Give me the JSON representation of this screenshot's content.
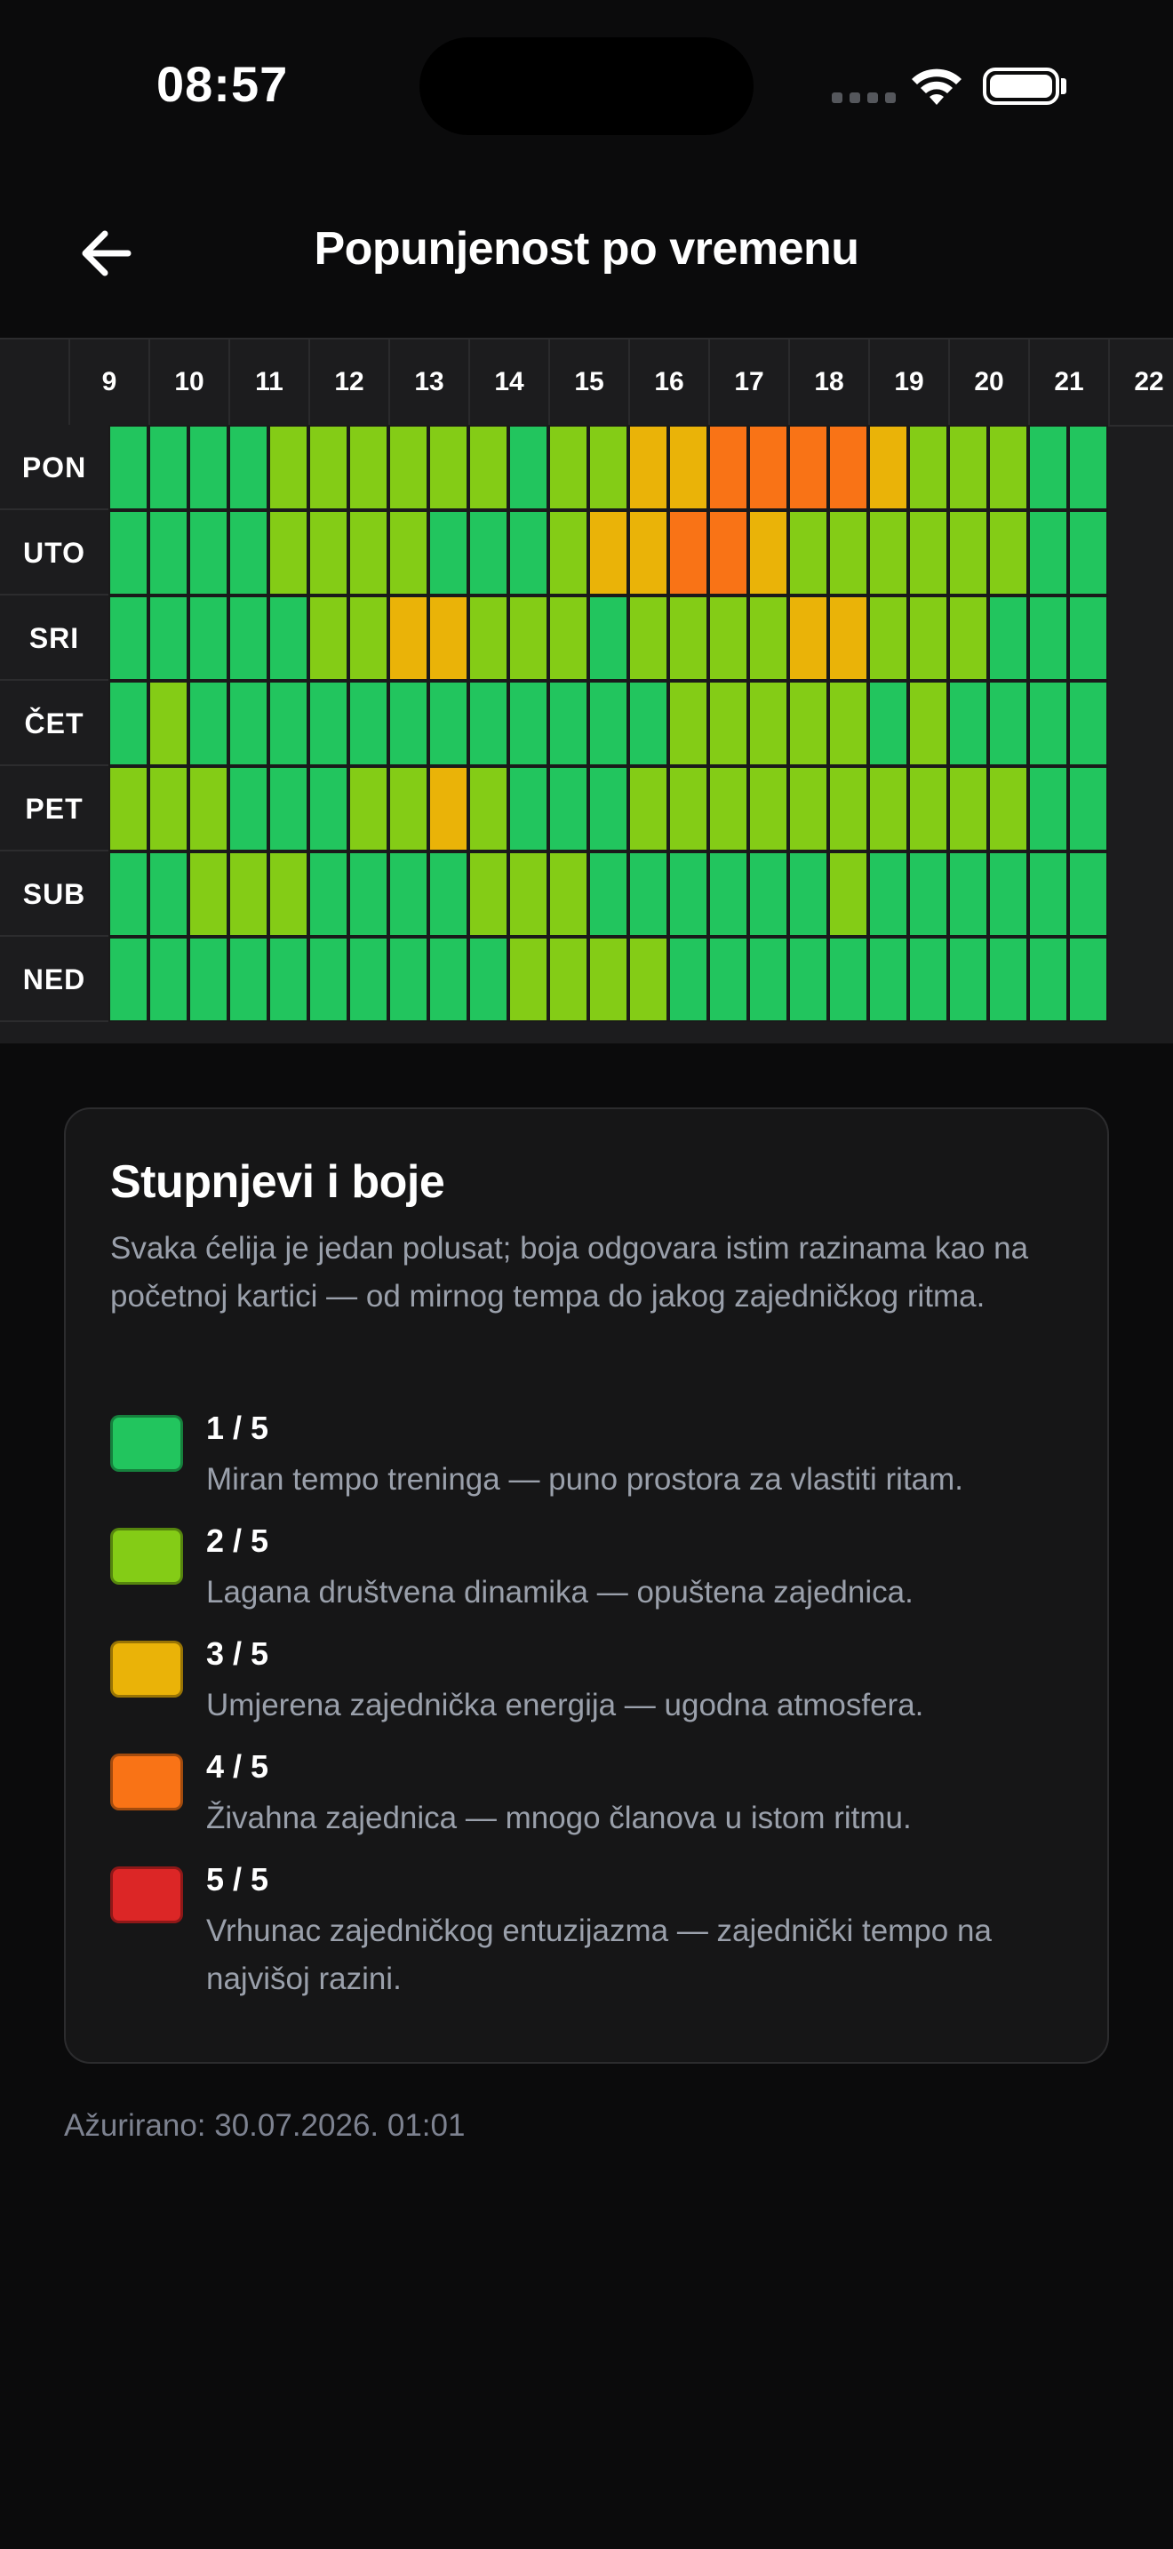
{
  "status_bar": {
    "time": "08:57"
  },
  "header": {
    "title": "Popunjenost po vremenu",
    "back_icon": "arrow-left-icon"
  },
  "heatmap": {
    "hours": [
      "9",
      "10",
      "11",
      "12",
      "13",
      "14",
      "15",
      "16",
      "17",
      "18",
      "19",
      "20",
      "21",
      "22"
    ],
    "days": [
      "PON",
      "UTO",
      "SRI",
      "ČET",
      "PET",
      "SUB",
      "NED"
    ],
    "level_colors": {
      "1": "#22c55e",
      "2": "#84cc16",
      "3": "#eab308",
      "4": "#f97316",
      "5": "#dc2626"
    },
    "levels": [
      [
        1,
        1,
        1,
        1,
        2,
        2,
        2,
        2,
        2,
        2,
        1,
        2,
        2,
        3,
        3,
        4,
        4,
        4,
        4,
        3,
        2,
        2,
        2,
        1,
        1
      ],
      [
        1,
        1,
        1,
        1,
        2,
        2,
        2,
        2,
        1,
        1,
        1,
        2,
        3,
        3,
        4,
        4,
        3,
        2,
        2,
        2,
        2,
        2,
        2,
        1,
        1
      ],
      [
        1,
        1,
        1,
        1,
        1,
        2,
        2,
        3,
        3,
        2,
        2,
        2,
        1,
        2,
        2,
        2,
        2,
        3,
        3,
        2,
        2,
        2,
        1,
        1,
        1
      ],
      [
        1,
        2,
        1,
        1,
        1,
        1,
        1,
        1,
        1,
        1,
        1,
        1,
        1,
        1,
        2,
        2,
        2,
        2,
        2,
        1,
        2,
        1,
        1,
        1,
        1
      ],
      [
        2,
        2,
        2,
        1,
        1,
        1,
        2,
        2,
        3,
        2,
        1,
        1,
        1,
        2,
        2,
        2,
        2,
        2,
        2,
        2,
        2,
        2,
        2,
        1,
        1
      ],
      [
        1,
        1,
        2,
        2,
        2,
        1,
        1,
        1,
        1,
        2,
        2,
        2,
        1,
        1,
        1,
        1,
        1,
        1,
        2,
        1,
        1,
        1,
        1,
        1,
        1
      ],
      [
        1,
        1,
        1,
        1,
        1,
        1,
        1,
        1,
        1,
        1,
        2,
        2,
        2,
        2,
        1,
        1,
        1,
        1,
        1,
        1,
        1,
        1,
        1,
        1,
        1
      ]
    ]
  },
  "legend": {
    "title": "Stupnjevi i boje",
    "description": "Svaka ćelija je jedan polusat; boja odgovara istim razinama kao na početnoj kartici — od mirnog tempa do jakog zajedničkog ritma.",
    "items": [
      {
        "level": "1 / 5",
        "description": "Miran tempo treninga — puno prostora za vlastiti ritam.",
        "color": "#22c55e"
      },
      {
        "level": "2 / 5",
        "description": "Lagana društvena dinamika — opuštena zajednica.",
        "color": "#84cc16"
      },
      {
        "level": "3 / 5",
        "description": "Umjerena zajednička energija — ugodna atmosfera.",
        "color": "#eab308"
      },
      {
        "level": "4 / 5",
        "description": "Živahna zajednica — mnogo članova u istom ritmu.",
        "color": "#f97316"
      },
      {
        "level": "5 / 5",
        "description": "Vrhunac zajedničkog entuzijazma — zajednički tempo na najvišoj razini.",
        "color": "#dc2626"
      }
    ]
  },
  "footer": {
    "updated": "Ažurirano: 30.07.2026. 01:01"
  }
}
